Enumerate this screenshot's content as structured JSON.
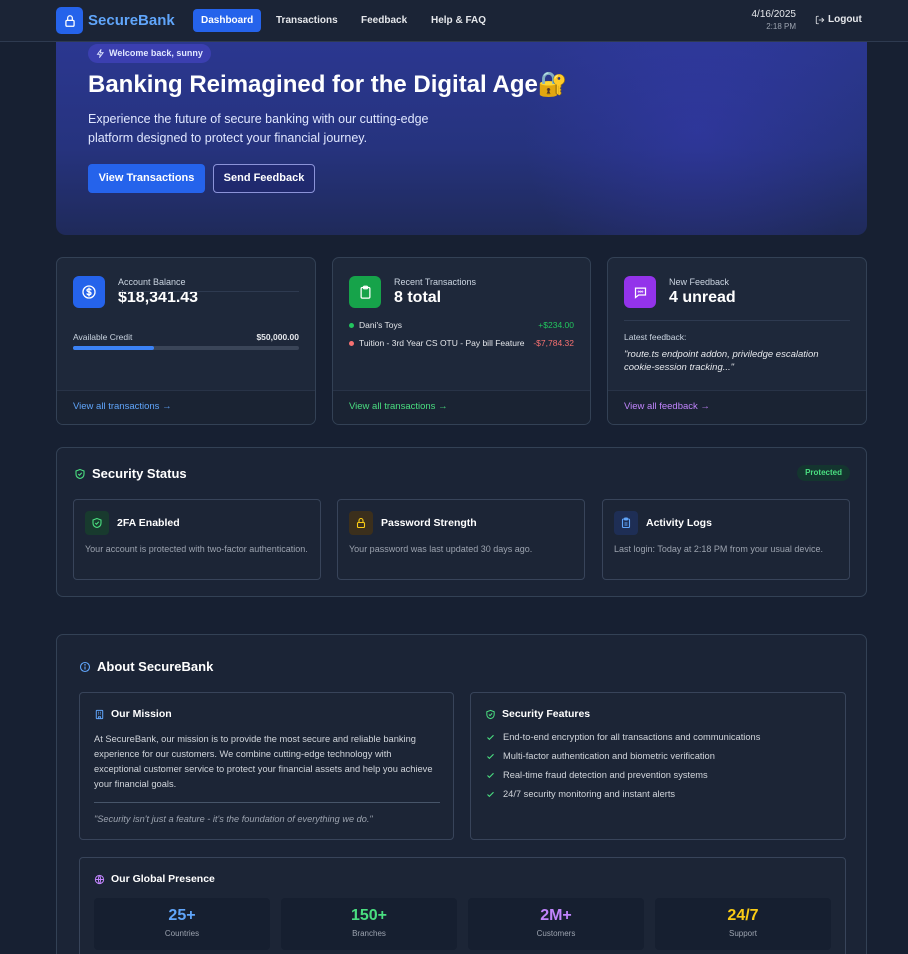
{
  "nav": {
    "brand": "SecureBank",
    "links": [
      "Dashboard",
      "Transactions",
      "Feedback",
      "Help & FAQ"
    ],
    "date": "4/16/2025",
    "time": "2:18 PM",
    "logout": "Logout"
  },
  "hero": {
    "welcome": "Welcome back, sunny",
    "title": "Banking Reimagined for the Digital Age",
    "title_emoji": "🔐",
    "subtitle": "Experience the future of secure banking with our cutting-edge platform designed to protect your financial journey.",
    "primary_button": "View Transactions",
    "secondary_button": "Send Feedback"
  },
  "cards": {
    "balance": {
      "label": "Account Balance",
      "value": "$18,341.43",
      "credit_label": "Available Credit",
      "credit_value": "$50,000.00",
      "credit_progress_pct": 36,
      "link": "View all transactions →"
    },
    "transactions": {
      "label": "Recent Transactions",
      "value": "8 total",
      "items": [
        {
          "name": "Dani's Toys",
          "amount": "+$234.00",
          "color": "#22c55e"
        },
        {
          "name": "Tuition - 3rd Year CS OTU - Pay bill Feature",
          "amount": "-$7,784.32",
          "color": "#f87171"
        }
      ],
      "link": "View all transactions →"
    },
    "feedback": {
      "label": "New Feedback",
      "value": "4 unread",
      "latest_label": "Latest feedback:",
      "latest": "\"route.ts endpoint addon, priviledge escalation cookie-session tracking...\"",
      "link": "View all feedback →"
    }
  },
  "security": {
    "title": "Security Status",
    "badge": "Protected",
    "items": [
      {
        "title": "2FA Enabled",
        "text": "Your account is protected with two-factor authentication.",
        "icon": "shield-check-icon"
      },
      {
        "title": "Password Strength",
        "text": "Your password was last updated 30 days ago.",
        "icon": "lock-icon"
      },
      {
        "title": "Activity Logs",
        "text": "Last login: Today at 2:18 PM from your usual device.",
        "icon": "clipboard-icon"
      }
    ]
  },
  "about": {
    "title": "About SecureBank",
    "mission": {
      "title": "Our Mission",
      "text": "At SecureBank, our mission is to provide the most secure and reliable banking experience for our customers. We combine cutting-edge technology with exceptional customer service to protect your financial assets and help you achieve your financial goals.",
      "quote": "\"Security isn't just a feature - it's the foundation of everything we do.\""
    },
    "features": {
      "title": "Security Features",
      "items": [
        "End-to-end encryption for all transactions and communications",
        "Multi-factor authentication and biometric verification",
        "Real-time fraud detection and prevention systems",
        "24/7 security monitoring and instant alerts"
      ]
    },
    "presence": {
      "title": "Our Global Presence",
      "stats": [
        {
          "value": "25+",
          "label": "Countries",
          "color": "#60a5fa"
        },
        {
          "value": "150+",
          "label": "Branches",
          "color": "#4ade80"
        },
        {
          "value": "2M+",
          "label": "Customers",
          "color": "#c084fc"
        },
        {
          "value": "24/7",
          "label": "Support",
          "color": "#facc15"
        }
      ]
    }
  }
}
